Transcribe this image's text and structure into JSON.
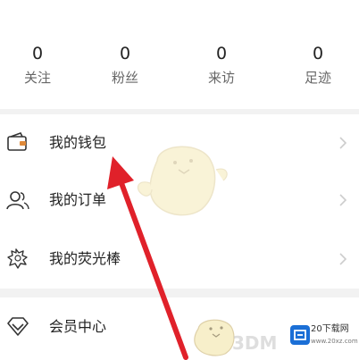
{
  "stats": [
    {
      "value": "0",
      "label": "关注"
    },
    {
      "value": "0",
      "label": "粉丝"
    },
    {
      "value": "0",
      "label": "来访"
    },
    {
      "value": "0",
      "label": "足迹"
    }
  ],
  "menu": [
    {
      "label": "我的钱包",
      "icon": "wallet-icon"
    },
    {
      "label": "我的订单",
      "icon": "user-order-icon"
    },
    {
      "label": "我的荧光棒",
      "icon": "glow-stick-icon"
    },
    {
      "label": "会员中心",
      "icon": "vip-diamond-icon"
    }
  ],
  "watermark": {
    "brand": "3DM",
    "site_name": "20下载网",
    "site_sub": "www.20xz.com"
  },
  "colors": {
    "arrow": "#e0212a",
    "divider": "#f2f2f2",
    "wallet_accent": "#e08a3a"
  }
}
